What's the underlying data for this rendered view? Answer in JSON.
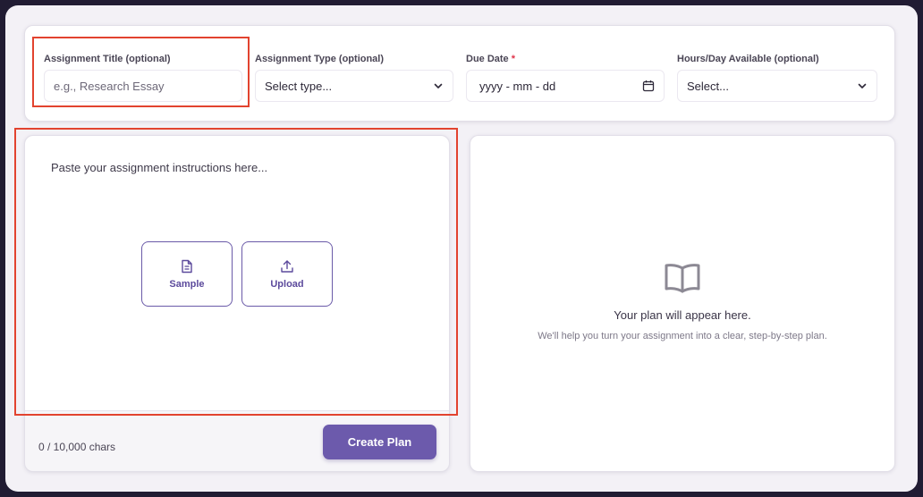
{
  "form": {
    "title_field": {
      "label": "Assignment Title (optional)",
      "placeholder": "e.g., Research Essay"
    },
    "type_field": {
      "label": "Assignment Type (optional)",
      "value": "Select type..."
    },
    "due_field": {
      "label": "Due Date",
      "required_mark": "*",
      "value": "yyyy - mm - dd"
    },
    "hours_field": {
      "label": "Hours/Day Available (optional)",
      "value": "Select..."
    }
  },
  "instructions": {
    "placeholder": "Paste your assignment instructions here...",
    "sample_label": "Sample",
    "upload_label": "Upload",
    "char_count": "0 / 10,000 chars",
    "create_label": "Create Plan"
  },
  "plan": {
    "empty_title": "Your plan will appear here.",
    "empty_subtitle": "We'll help you turn your assignment into a clear, step-by-step plan."
  },
  "colors": {
    "accent": "#6c5aac",
    "highlight": "#e2432f",
    "required": "#e0344b",
    "background": "#211c33"
  },
  "icons": [
    "chevron-down-icon",
    "calendar-icon",
    "document-icon",
    "upload-icon",
    "book-open-icon"
  ]
}
